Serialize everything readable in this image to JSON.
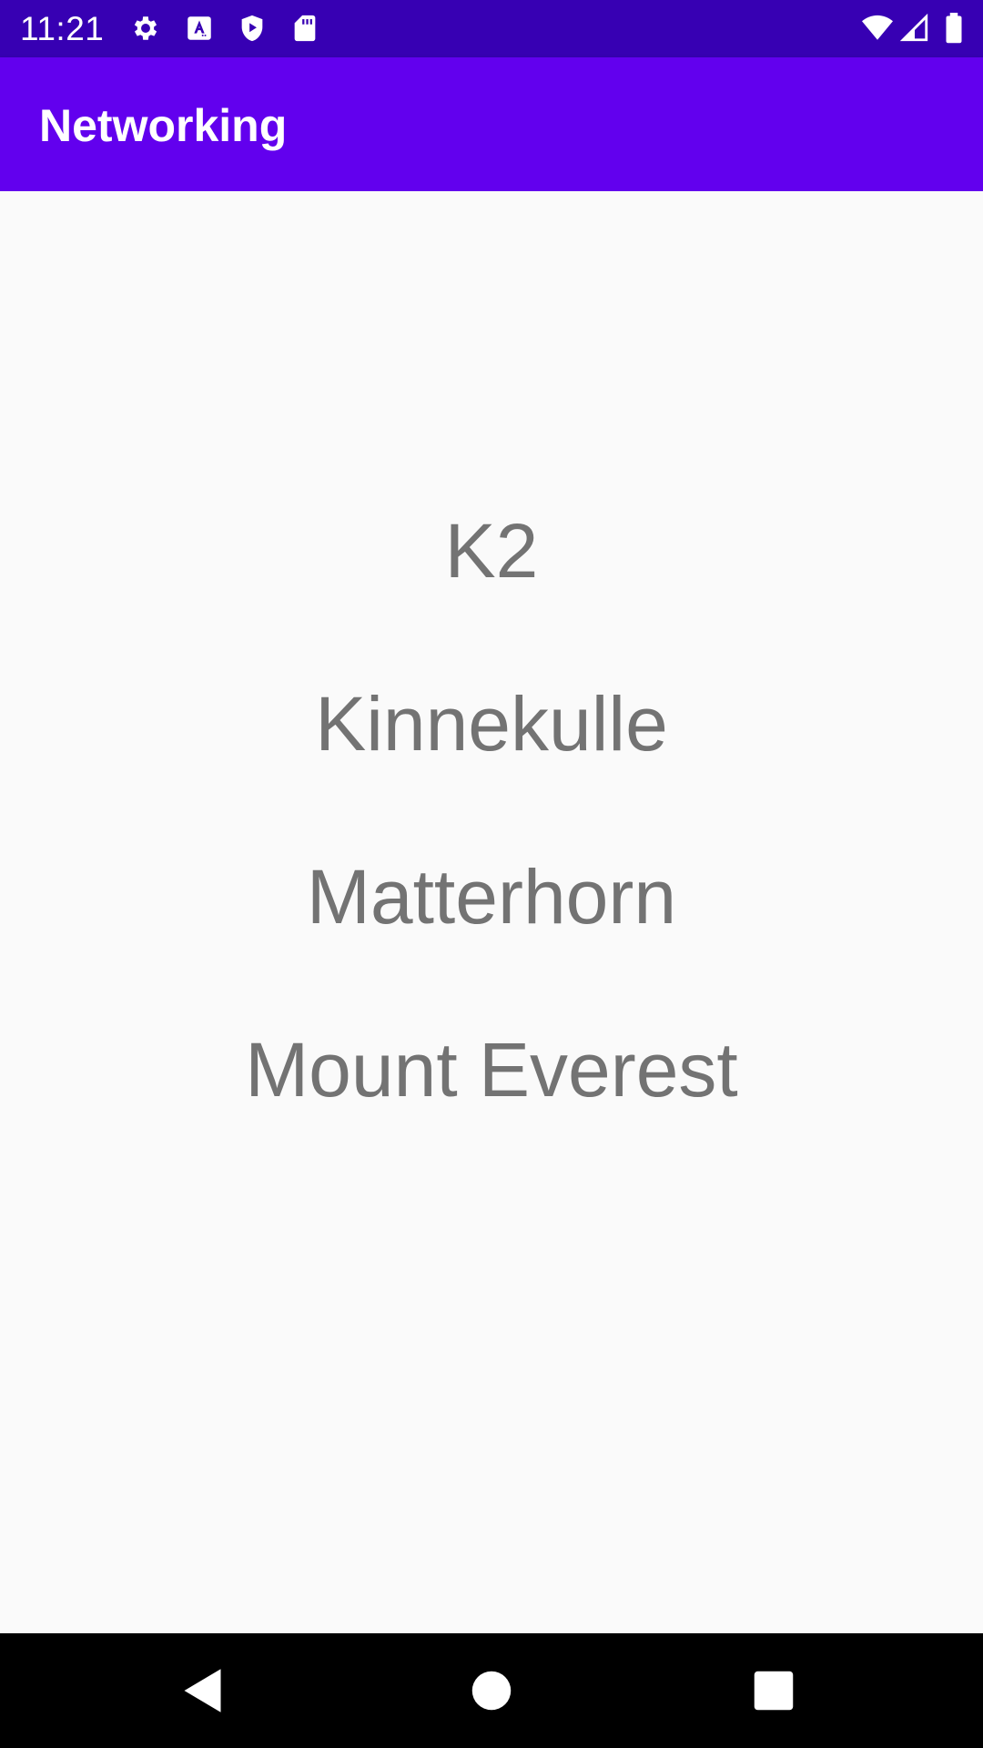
{
  "status_bar": {
    "time": "11:21",
    "background": "#3700b3",
    "left_icons": [
      "gear-icon",
      "accessibility-a-icon",
      "shield-play-icon",
      "sd-card-icon"
    ],
    "right_icons": [
      "wifi-icon",
      "cell-signal-icon",
      "battery-icon"
    ]
  },
  "app_bar": {
    "title": "Networking",
    "background": "#6200ee"
  },
  "mountains": [
    {
      "name": "K2"
    },
    {
      "name": "Kinnekulle"
    },
    {
      "name": "Matterhorn"
    },
    {
      "name": "Mount Everest"
    }
  ],
  "nav_bar": {
    "buttons": [
      "back-icon",
      "home-icon",
      "recents-icon"
    ]
  }
}
